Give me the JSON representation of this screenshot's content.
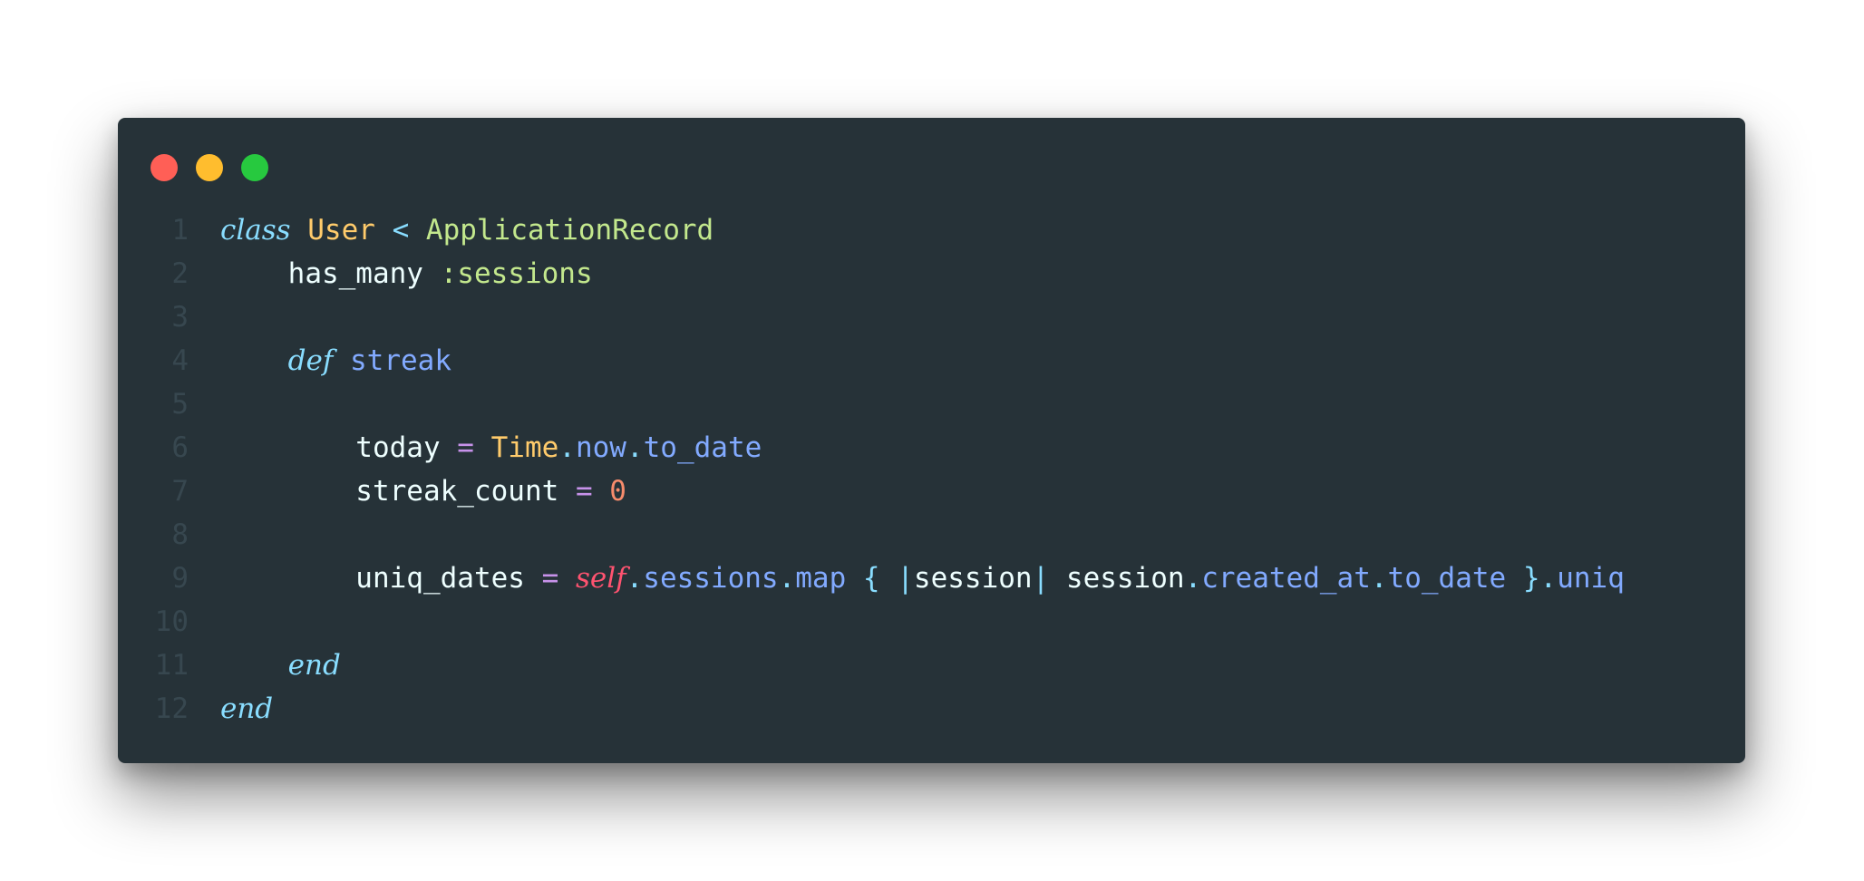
{
  "window": {
    "controls": [
      "close",
      "minimize",
      "maximize"
    ],
    "colors": {
      "background": "#263238",
      "close": "#ff5f56",
      "minimize": "#ffbd2e",
      "maximize": "#27c93f"
    }
  },
  "code": {
    "lines": [
      {
        "number": "1",
        "tokens": [
          {
            "t": "class",
            "c": "kw"
          },
          {
            "t": " ",
            "c": "txt"
          },
          {
            "t": "User",
            "c": "cls"
          },
          {
            "t": " < ",
            "c": "op"
          },
          {
            "t": "ApplicationRecord",
            "c": "green"
          }
        ]
      },
      {
        "number": "2",
        "tokens": [
          {
            "t": "    has_many ",
            "c": "txt"
          },
          {
            "t": ":sessions",
            "c": "green"
          }
        ]
      },
      {
        "number": "3",
        "tokens": []
      },
      {
        "number": "4",
        "tokens": [
          {
            "t": "    ",
            "c": "txt"
          },
          {
            "t": "def",
            "c": "kw"
          },
          {
            "t": " ",
            "c": "txt"
          },
          {
            "t": "streak",
            "c": "fn"
          }
        ]
      },
      {
        "number": "5",
        "tokens": []
      },
      {
        "number": "6",
        "tokens": [
          {
            "t": "        today ",
            "c": "txt"
          },
          {
            "t": "=",
            "c": "pink"
          },
          {
            "t": " ",
            "c": "txt"
          },
          {
            "t": "Time",
            "c": "cls"
          },
          {
            "t": ".",
            "c": "punc"
          },
          {
            "t": "now",
            "c": "fn"
          },
          {
            "t": ".",
            "c": "punc"
          },
          {
            "t": "to_date",
            "c": "fn"
          }
        ]
      },
      {
        "number": "7",
        "tokens": [
          {
            "t": "        streak_count ",
            "c": "txt"
          },
          {
            "t": "=",
            "c": "pink"
          },
          {
            "t": " ",
            "c": "txt"
          },
          {
            "t": "0",
            "c": "num"
          }
        ]
      },
      {
        "number": "8",
        "tokens": []
      },
      {
        "number": "9",
        "tokens": [
          {
            "t": "        uniq_dates ",
            "c": "txt"
          },
          {
            "t": "=",
            "c": "pink"
          },
          {
            "t": " ",
            "c": "txt"
          },
          {
            "t": "self",
            "c": "self"
          },
          {
            "t": ".",
            "c": "punc"
          },
          {
            "t": "sessions",
            "c": "fn"
          },
          {
            "t": ".",
            "c": "punc"
          },
          {
            "t": "map",
            "c": "fn"
          },
          {
            "t": " { |",
            "c": "punc"
          },
          {
            "t": "session",
            "c": "txt"
          },
          {
            "t": "| ",
            "c": "punc"
          },
          {
            "t": "session",
            "c": "txt"
          },
          {
            "t": ".",
            "c": "punc"
          },
          {
            "t": "created_at",
            "c": "fn"
          },
          {
            "t": ".",
            "c": "punc"
          },
          {
            "t": "to_date",
            "c": "fn"
          },
          {
            "t": " }",
            "c": "punc"
          },
          {
            "t": ".",
            "c": "punc"
          },
          {
            "t": "uniq",
            "c": "fn"
          }
        ]
      },
      {
        "number": "10",
        "tokens": []
      },
      {
        "number": "11",
        "tokens": [
          {
            "t": "    ",
            "c": "txt"
          },
          {
            "t": "end",
            "c": "kw"
          }
        ]
      },
      {
        "number": "12",
        "tokens": [
          {
            "t": "end",
            "c": "kw"
          }
        ]
      }
    ]
  }
}
